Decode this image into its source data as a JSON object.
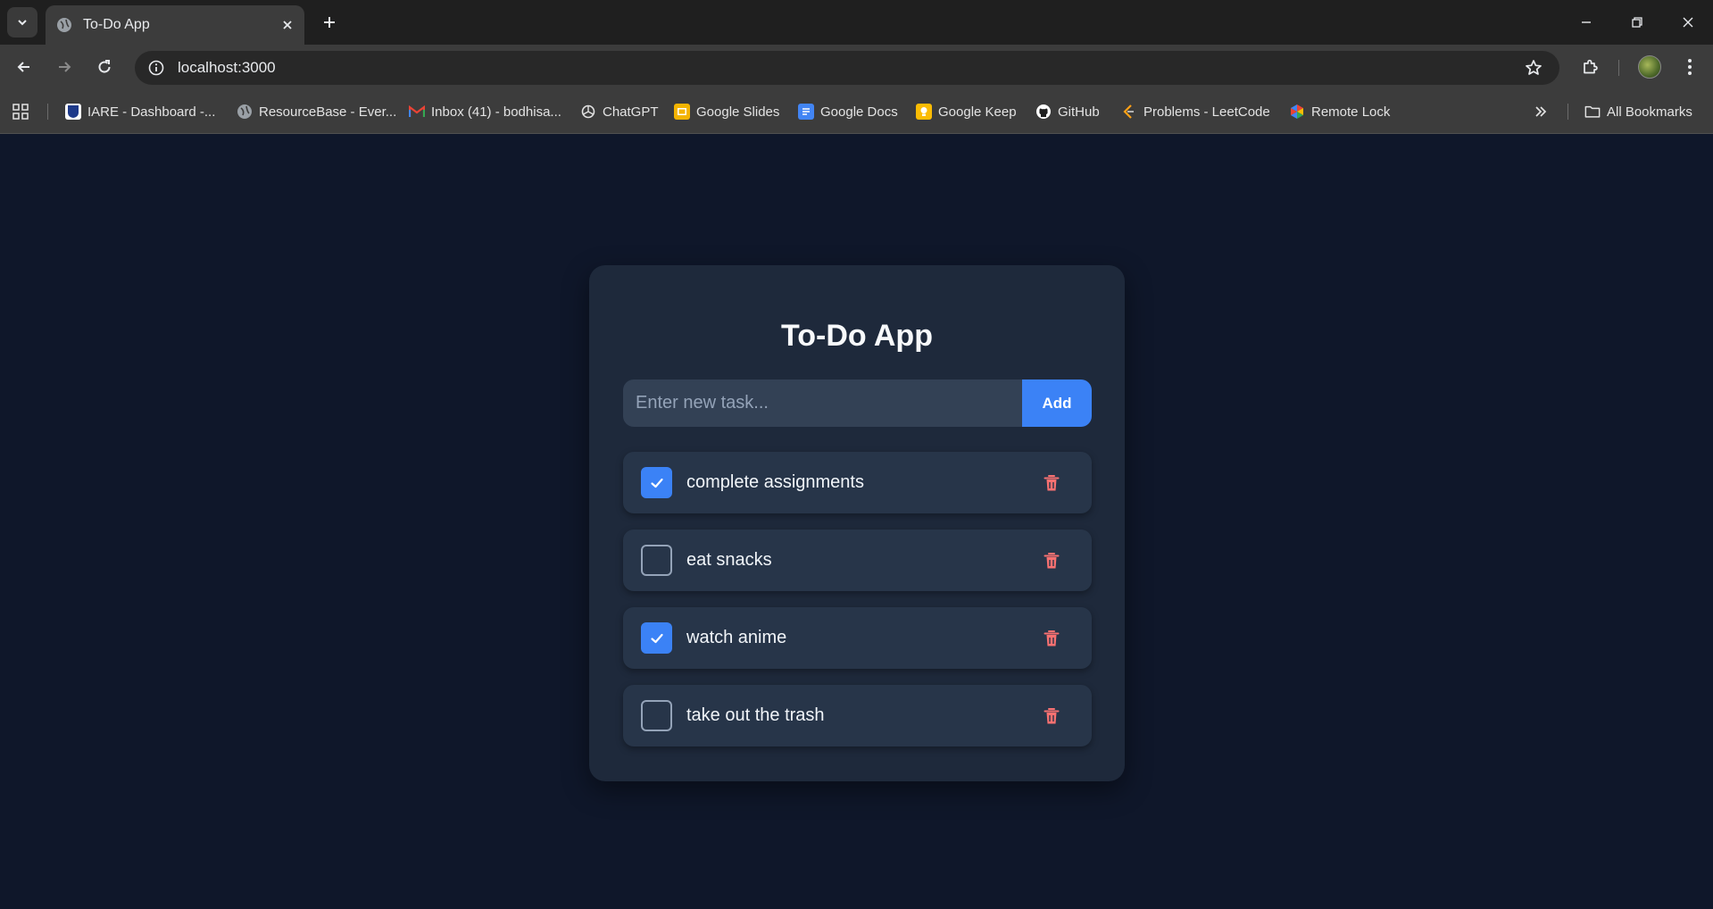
{
  "browser": {
    "tab_title": "To-Do App",
    "url": "localhost:3000",
    "bookmarks": [
      {
        "label": "IARE - Dashboard -...",
        "icon": "iare-icon",
        "color": "#1e3a8a"
      },
      {
        "label": "ResourceBase - Ever...",
        "icon": "globe-icon",
        "color": "#9aa0a6"
      },
      {
        "label": "Inbox (41) - bodhisa...",
        "icon": "gmail-icon",
        "color": "#ea4335"
      },
      {
        "label": "ChatGPT",
        "icon": "chatgpt-icon",
        "color": "#e3e3e3"
      },
      {
        "label": "Google Slides",
        "icon": "slides-icon",
        "color": "#f4b400"
      },
      {
        "label": "Google Docs",
        "icon": "docs-icon",
        "color": "#4285f4"
      },
      {
        "label": "Google Keep",
        "icon": "keep-icon",
        "color": "#fbbc04"
      },
      {
        "label": "GitHub",
        "icon": "github-icon",
        "color": "#ffffff"
      },
      {
        "label": "Problems - LeetCode",
        "icon": "leetcode-icon",
        "color": "#ffa116"
      },
      {
        "label": "Remote Lock",
        "icon": "remote-lock-icon",
        "color": "#4285f4"
      }
    ],
    "all_bookmarks": "All Bookmarks"
  },
  "app": {
    "title": "To-Do App",
    "input_placeholder": "Enter new task...",
    "add_label": "Add",
    "tasks": [
      {
        "text": "complete assignments",
        "done": true
      },
      {
        "text": "eat snacks",
        "done": false
      },
      {
        "text": "watch anime",
        "done": true
      },
      {
        "text": "take out the trash",
        "done": false
      }
    ]
  },
  "colors": {
    "background": "#0f172a",
    "card": "#1e293b",
    "accent": "#3b82f6",
    "delete": "#f87171"
  }
}
